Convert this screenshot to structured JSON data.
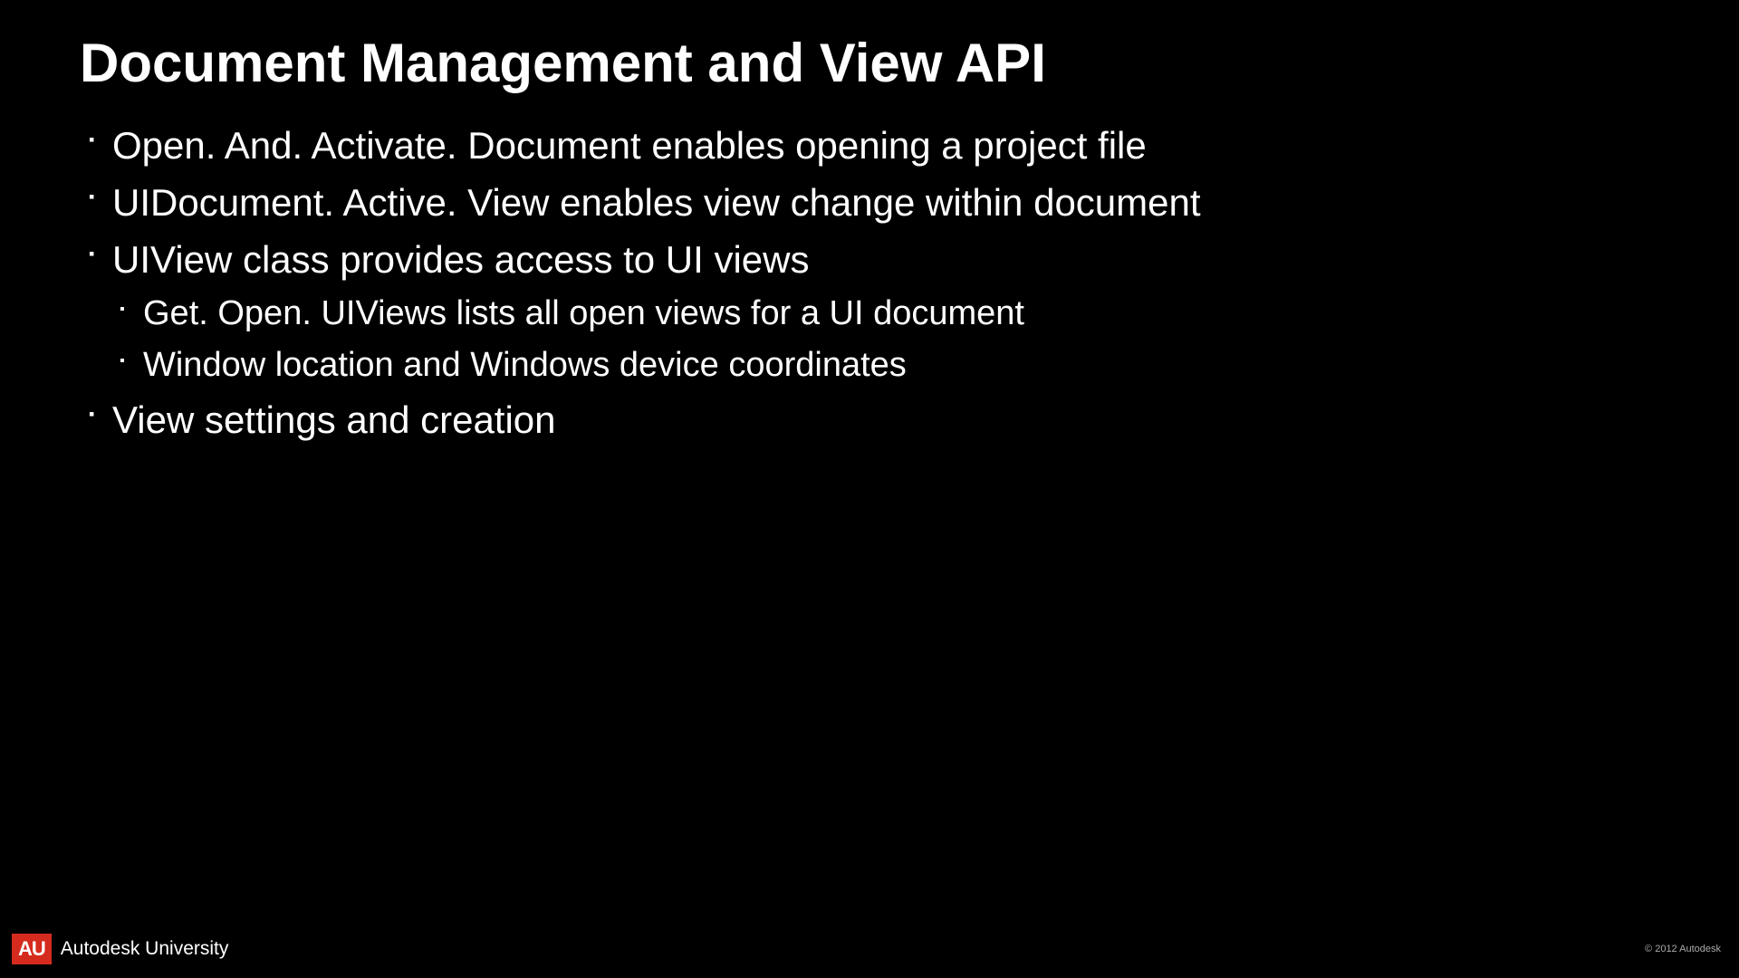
{
  "title": "Document Management and View API",
  "bullets": [
    {
      "text": "Open. And. Activate. Document enables opening a project file"
    },
    {
      "text": "UIDocument. Active. View enables view change within document"
    },
    {
      "text": "UIView class provides access to UI views",
      "sub": [
        "Get. Open. UIViews lists all open views for a UI document",
        "Window location and Windows device coordinates"
      ]
    },
    {
      "text": "View settings and creation"
    }
  ],
  "footer": {
    "logo_badge": "AU",
    "logo_text_bold": "Autodesk",
    "logo_text_light": " University",
    "copyright": "© 2012 Autodesk"
  }
}
